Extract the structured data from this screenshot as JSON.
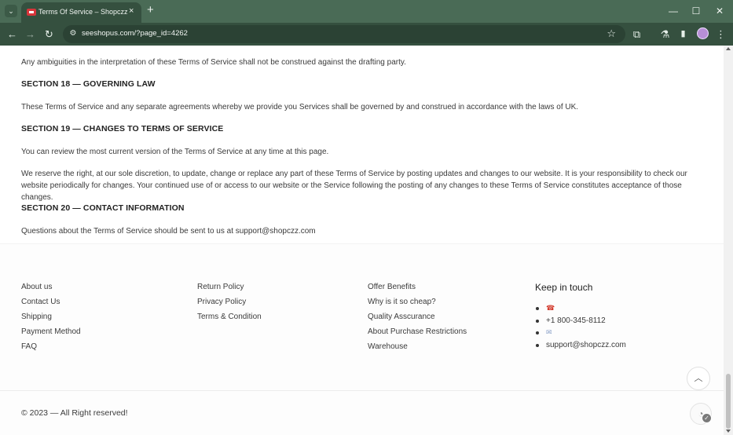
{
  "browser": {
    "tab_title": "Terms Of Service – Shopczz",
    "new_tab": "+",
    "close_tab": "×",
    "url": "seeshopus.com/?page_id=4262",
    "window": {
      "minimize": "—",
      "maximize": "☐",
      "close": "✕"
    },
    "nav": {
      "back": "←",
      "forward": "→",
      "reload": "↻",
      "star": "☆",
      "extensions": "⧉",
      "labs": "⚗",
      "sidebar": "▮",
      "menu": "⋮",
      "tune": "⚙",
      "tab_menu": "⌄"
    },
    "colors": {
      "frame": "#4a6b56",
      "toolbar": "#35503f"
    }
  },
  "terms": {
    "p_ambiguities": "Any ambiguities in the interpretation of these Terms of Service shall not be construed against the drafting party.",
    "s18_title": "SECTION 18 — GOVERNING LAW",
    "s18_body": "These Terms of Service and any separate agreements whereby we provide you Services shall be governed by and construed in accordance with the laws of UK.",
    "s19_title": "SECTION 19 — CHANGES TO TERMS OF SERVICE",
    "s19_body1": "You can review the most current version of the Terms of Service at any time at this page.",
    "s19_body2": "We reserve the right, at our sole discretion, to update, change or replace any part of these Terms of Service by posting updates and changes to our website. It is your responsibility to check our website periodically for changes. Your continued use of or access to our website or the Service following the posting of any changes to these Terms of Service constitutes acceptance of those changes.",
    "s20_title": "SECTION 20 — CONTACT INFORMATION",
    "s20_body": "Questions about the Terms of Service should be sent to us at support@shopczz.com"
  },
  "footer": {
    "col1": [
      "About us",
      "Contact Us",
      "Shipping",
      "Payment Method",
      "FAQ"
    ],
    "col2": [
      "Return Policy",
      "Privacy Policy",
      "Terms & Condition"
    ],
    "col3": [
      "Offer Benefits",
      "Why is it so cheap?",
      "Quality Asscurance",
      "About Purchase Restrictions",
      "Warehouse"
    ],
    "keep_title": "Keep in touch",
    "phone_icon": "☎",
    "phone": "+1 800-345-8112",
    "mail_icon": "✉",
    "email": "support@shopczz.com",
    "copyright": "© 2023 — All Right reserved!",
    "to_top": "︿",
    "chat": "◔",
    "chat_badge": "✓"
  }
}
